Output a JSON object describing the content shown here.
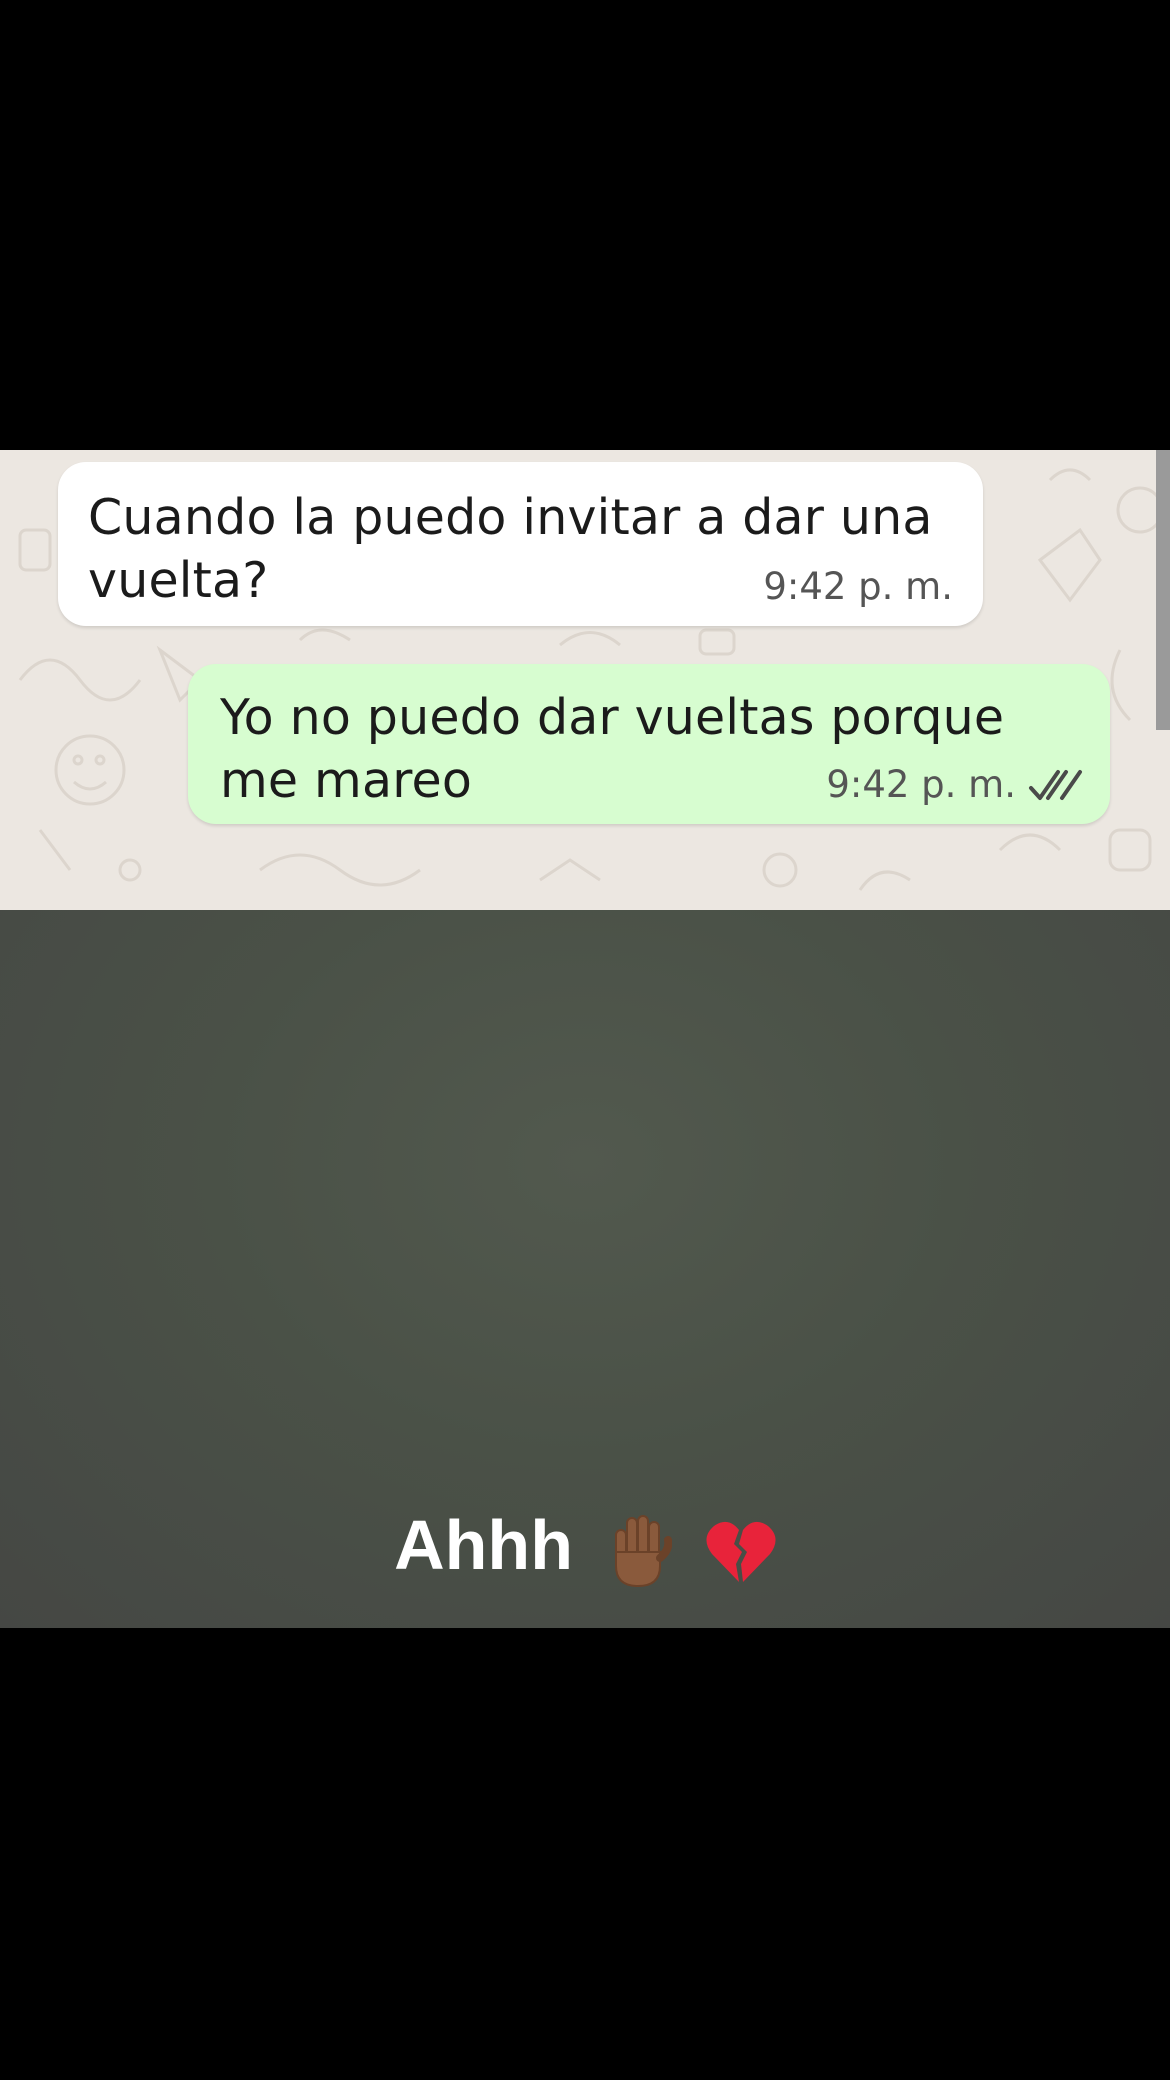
{
  "chat": {
    "messages": [
      {
        "direction": "incoming",
        "text": "Cuando la puedo invitar a dar una vuelta?",
        "time": "9:42 p. m."
      },
      {
        "direction": "outgoing",
        "text": "Yo no puedo dar vueltas porque me mareo",
        "time": "9:42 p. m.",
        "status_icon": "double-check-read-icon"
      }
    ]
  },
  "story": {
    "caption": "Ahhh",
    "emoji_icons": [
      "raised-hand-icon",
      "broken-heart-icon"
    ]
  },
  "colors": {
    "chat_background": "#ece7e1",
    "incoming_bubble": "#ffffff",
    "outgoing_bubble": "#d7fdd0",
    "story_background": "#4d544b",
    "frame_background": "#000000"
  }
}
